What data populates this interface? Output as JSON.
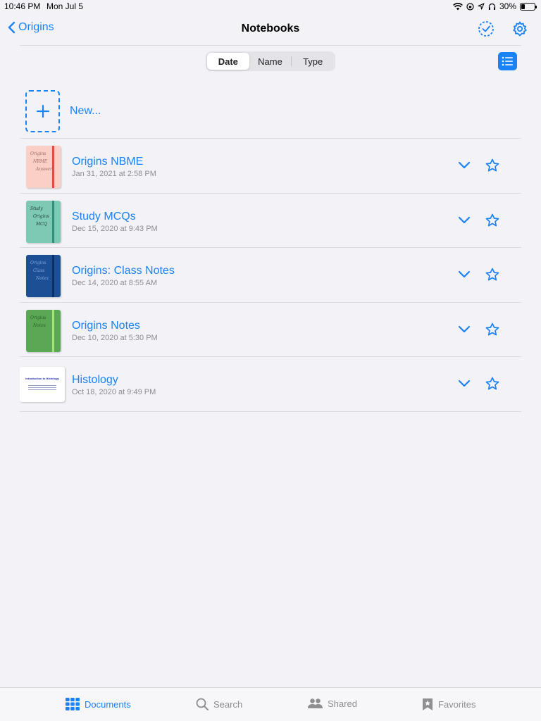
{
  "status": {
    "time": "10:46 PM",
    "date": "Mon Jul 5",
    "battery": "30%",
    "battery_level": 0.3
  },
  "nav": {
    "back_label": "Origins",
    "title": "Notebooks"
  },
  "sort": {
    "options": [
      "Date",
      "Name",
      "Type"
    ],
    "selected": "Date"
  },
  "new_label": "New...",
  "notebooks": [
    {
      "title": "Origins NBME",
      "date": "Jan 31, 2021 at 2:58 PM",
      "cover": "#f9cfc6",
      "band": "#e64a3c",
      "ink": "#a06b60",
      "lines": [
        "Origins",
        "NBME",
        "Answers"
      ]
    },
    {
      "title": "Study MCQs",
      "date": "Dec 15, 2020 at 9:43 PM",
      "cover": "#7ec9b4",
      "band": "#2f8f7d",
      "ink": "#1d3b34",
      "lines": [
        "Study",
        "Origins",
        "MCQ"
      ]
    },
    {
      "title": "Origins: Class Notes",
      "date": "Dec 14, 2020 at 8:55 AM",
      "cover": "#1d4f94",
      "band": "#0c2f63",
      "ink": "#7fa7e0",
      "lines": [
        "Origins",
        "Class",
        "Notes"
      ]
    },
    {
      "title": "Origins Notes",
      "date": "Dec 10, 2020 at 5:30 PM",
      "cover": "#5aa855",
      "band": "#a6e27a",
      "ink": "#2b5f28",
      "lines": [
        "Origins",
        "Notes"
      ]
    },
    {
      "title": "Histology",
      "date": "Oct 18, 2020 at 9:49 PM",
      "cover": "#ffffff",
      "doc_title": "Introduction to Histology"
    }
  ],
  "tabs": [
    {
      "label": "Documents",
      "icon": "grid-icon",
      "active": true
    },
    {
      "label": "Search",
      "icon": "search-icon",
      "active": false
    },
    {
      "label": "Shared",
      "icon": "people-icon",
      "active": false
    },
    {
      "label": "Favorites",
      "icon": "bookmark-star-icon",
      "active": false
    }
  ],
  "colors": {
    "accent": "#1a82f7",
    "background": "#f2f2f7",
    "secondary_text": "#8e8e93"
  }
}
